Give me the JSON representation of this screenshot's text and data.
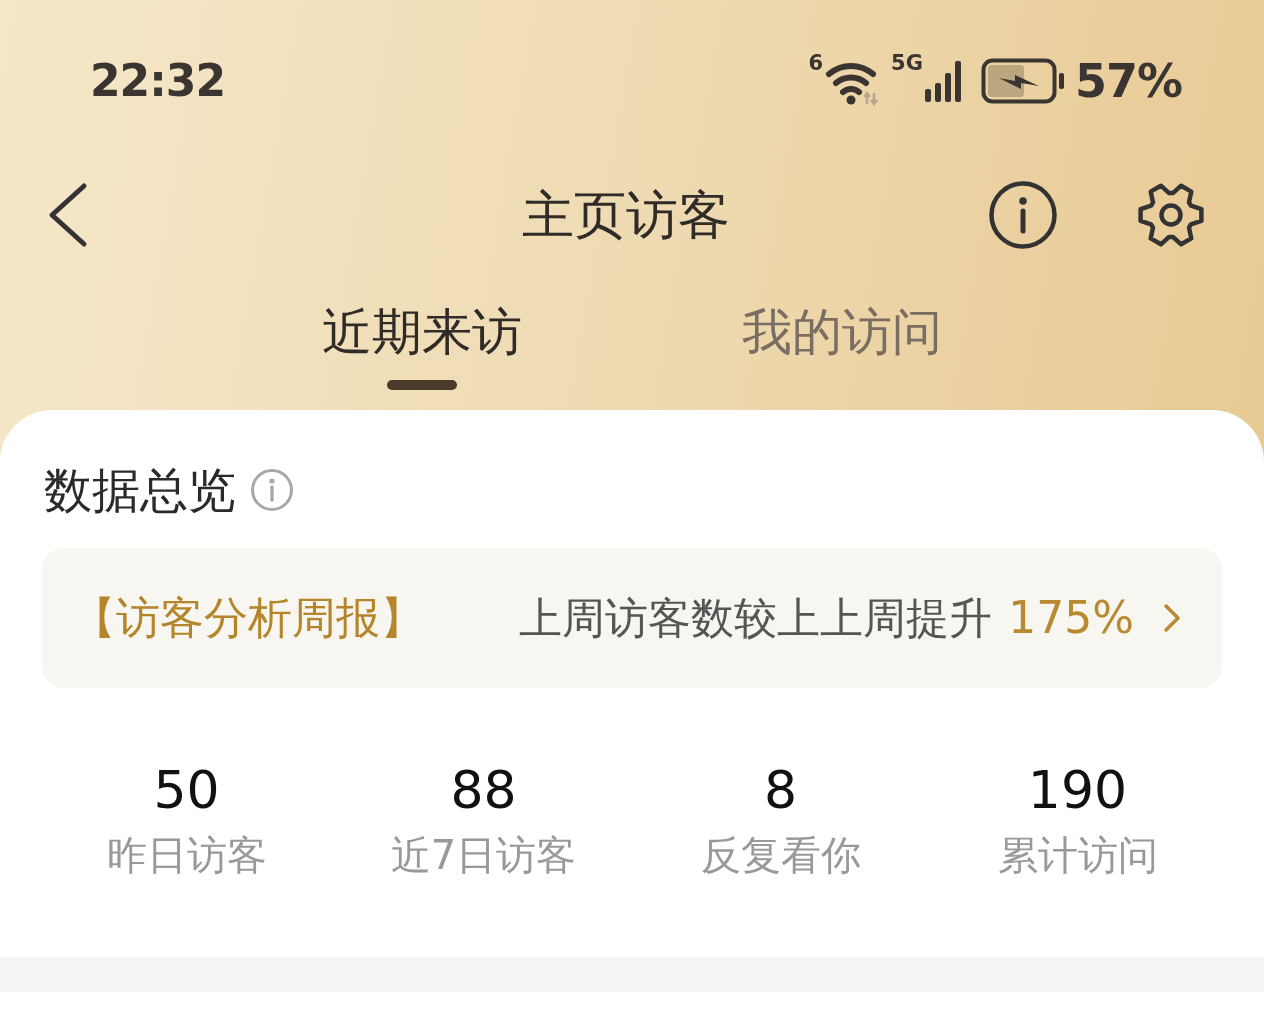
{
  "status_bar": {
    "time": "22:32",
    "wifi_label": "6",
    "network": "5G",
    "battery": "57%"
  },
  "header": {
    "title": "主页访客"
  },
  "tabs": [
    {
      "label": "近期来访",
      "selected": true
    },
    {
      "label": "我的访问",
      "selected": false
    }
  ],
  "overview": {
    "title": "数据总览",
    "report": {
      "label": "【访客分析周报】",
      "message": "上周访客数较上上周提升",
      "value": "175%"
    },
    "stats": [
      {
        "value": "50",
        "label": "昨日访客"
      },
      {
        "value": "88",
        "label": "近7日访客"
      },
      {
        "value": "8",
        "label": "反复看你"
      },
      {
        "value": "190",
        "label": "累计访问"
      }
    ]
  }
}
